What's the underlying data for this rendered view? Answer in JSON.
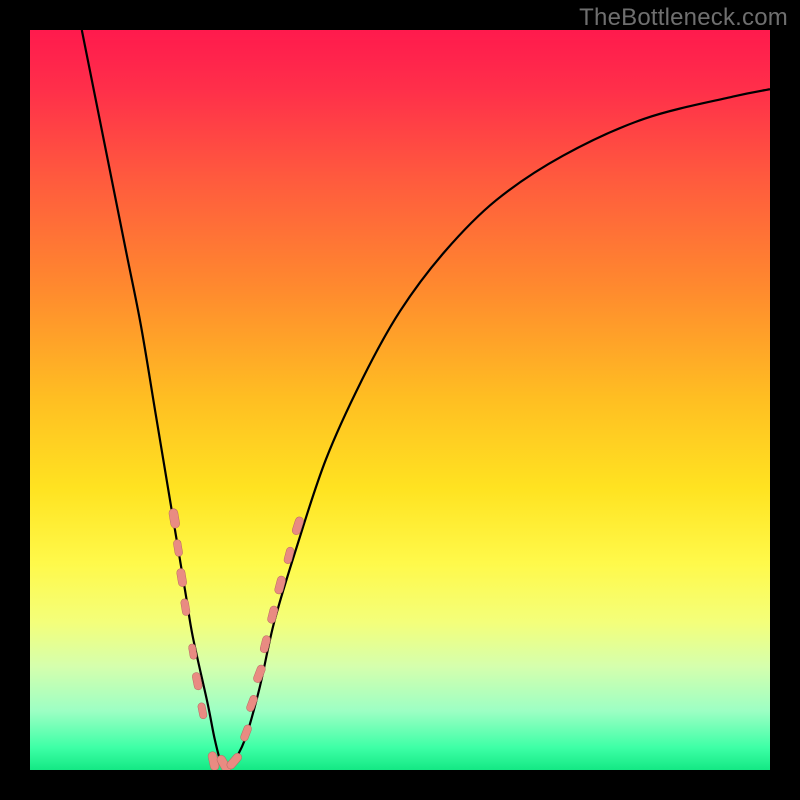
{
  "watermark": "TheBottleneck.com",
  "colors": {
    "frame": "#000000",
    "gradient_stops": [
      {
        "offset": 0.0,
        "color": "#ff1a4d"
      },
      {
        "offset": 0.08,
        "color": "#ff2f4a"
      },
      {
        "offset": 0.2,
        "color": "#ff5a3e"
      },
      {
        "offset": 0.35,
        "color": "#ff8a2e"
      },
      {
        "offset": 0.5,
        "color": "#ffbf22"
      },
      {
        "offset": 0.62,
        "color": "#ffe321"
      },
      {
        "offset": 0.72,
        "color": "#fff94a"
      },
      {
        "offset": 0.8,
        "color": "#f4ff7a"
      },
      {
        "offset": 0.86,
        "color": "#d5ffad"
      },
      {
        "offset": 0.92,
        "color": "#9dffc4"
      },
      {
        "offset": 0.97,
        "color": "#3dffa6"
      },
      {
        "offset": 1.0,
        "color": "#14e884"
      }
    ],
    "curve": "#000000",
    "marker_fill": "#e98b82",
    "marker_stroke": "#b86a63"
  },
  "chart_data": {
    "type": "line",
    "title": "",
    "xlabel": "",
    "ylabel": "",
    "xlim": [
      0,
      100
    ],
    "ylim": [
      0,
      100
    ],
    "grid": false,
    "legend": false,
    "series": [
      {
        "name": "bottleneck-curve",
        "x": [
          7,
          10,
          13,
          15,
          17,
          19,
          21,
          22,
          24,
          25,
          26,
          27,
          29,
          31,
          33,
          36,
          40,
          45,
          50,
          56,
          63,
          72,
          83,
          95,
          100
        ],
        "y": [
          100,
          85,
          70,
          60,
          48,
          36,
          24,
          18,
          9,
          4,
          0.5,
          0.5,
          4,
          11,
          20,
          30,
          42,
          53,
          62,
          70,
          77,
          83,
          88,
          91,
          92
        ]
      }
    ],
    "markers": [
      {
        "x": 19.5,
        "y": 34,
        "r": 2.8
      },
      {
        "x": 20.0,
        "y": 30,
        "r": 2.4
      },
      {
        "x": 20.5,
        "y": 26,
        "r": 2.6
      },
      {
        "x": 21.0,
        "y": 22,
        "r": 2.4
      },
      {
        "x": 22.0,
        "y": 16,
        "r": 2.2
      },
      {
        "x": 22.6,
        "y": 12,
        "r": 2.5
      },
      {
        "x": 23.3,
        "y": 8,
        "r": 2.3
      },
      {
        "x": 24.8,
        "y": 1.2,
        "r": 2.7
      },
      {
        "x": 26.2,
        "y": 0.8,
        "r": 2.7
      },
      {
        "x": 27.6,
        "y": 1.2,
        "r": 2.6
      },
      {
        "x": 29.2,
        "y": 5,
        "r": 2.4
      },
      {
        "x": 30.0,
        "y": 9,
        "r": 2.4
      },
      {
        "x": 31.0,
        "y": 13,
        "r": 2.6
      },
      {
        "x": 31.8,
        "y": 17,
        "r": 2.5
      },
      {
        "x": 32.8,
        "y": 21,
        "r": 2.5
      },
      {
        "x": 33.8,
        "y": 25,
        "r": 2.6
      },
      {
        "x": 35.0,
        "y": 29,
        "r": 2.4
      },
      {
        "x": 36.2,
        "y": 33,
        "r": 2.6
      }
    ]
  }
}
